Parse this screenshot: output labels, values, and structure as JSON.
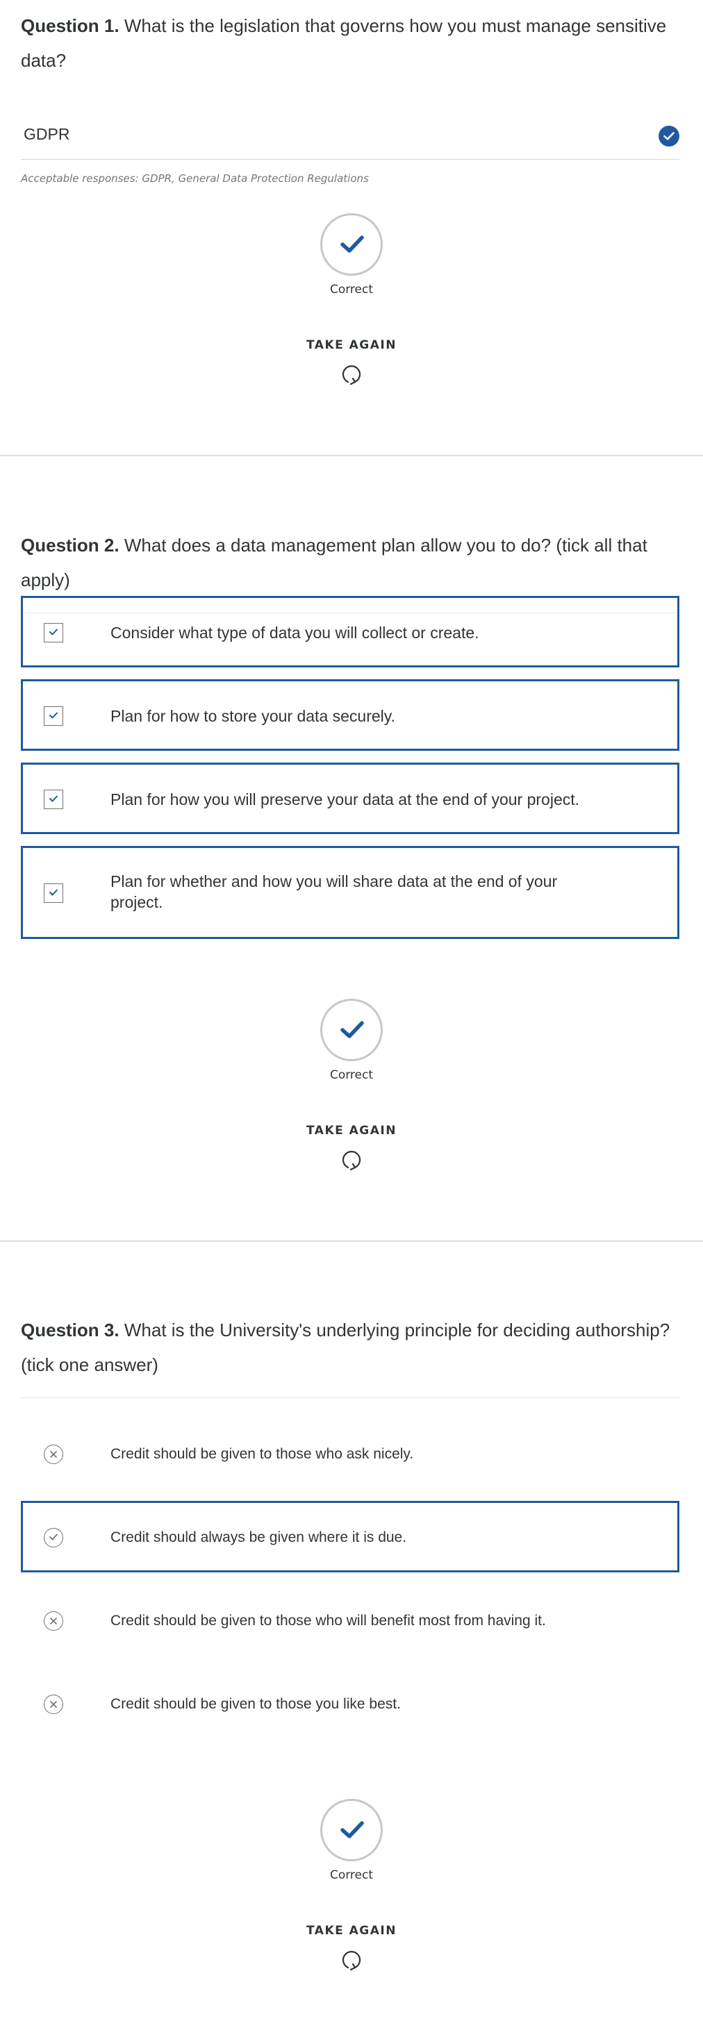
{
  "question1": {
    "number": "Question 1.",
    "text": "What is the legislation that governs how you must manage sensitive data?",
    "answer": "GDPR",
    "answer_status_icon": "check-circle-icon",
    "acceptable": "Acceptable responses: GDPR, General Data Protection Regulations",
    "result_label": "Correct",
    "take_again": "TAKE AGAIN"
  },
  "question2": {
    "number": "Question 2.",
    "text": "What does a data management plan allow you to do? (tick all that apply)",
    "choices": [
      {
        "label": "Consider what type of data you will collect or create.",
        "checked": true
      },
      {
        "label": "Plan for how to store your data securely.",
        "checked": true
      },
      {
        "label": "Plan for how you will preserve your data at the end of your project.",
        "checked": true
      },
      {
        "label": "Plan for whether and how you will share data at the end of your project.",
        "checked": true
      }
    ],
    "result_label": "Correct",
    "take_again": "TAKE AGAIN"
  },
  "question3": {
    "number": "Question 3.",
    "text": "What is the University's underlying principle for deciding authorship? (tick one answer)",
    "choices": [
      {
        "label": "Credit should be given to those who ask nicely.",
        "selected": false
      },
      {
        "label": "Credit should always be given where it is due.",
        "selected": true
      },
      {
        "label": "Credit should be given to those who will benefit most from having it.",
        "selected": false
      },
      {
        "label": "Credit should be given to those you like best.",
        "selected": false
      }
    ],
    "result_label": "Correct",
    "take_again": "TAKE AGAIN"
  },
  "colors": {
    "accent": "#1e5aa0",
    "text": "#313537",
    "muted": "#73777a",
    "divider": "#dcdedf"
  }
}
